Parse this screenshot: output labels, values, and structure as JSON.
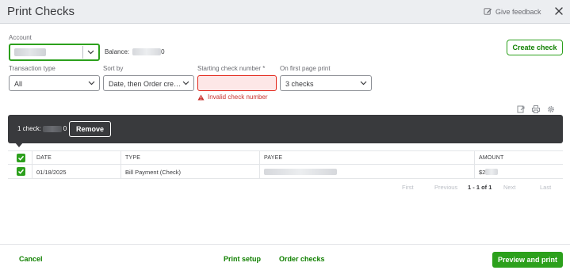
{
  "header": {
    "title": "Print Checks",
    "feedback_label": "Give feedback",
    "feedback_icon": "feedback-pencil-icon",
    "close_icon": "close-icon"
  },
  "form": {
    "account_label": "Account",
    "account_value": "",
    "balance_label": "Balance:",
    "balance_suffix": "0",
    "create_check_label": "Create check",
    "transaction_type_label": "Transaction type",
    "transaction_type_value": "All",
    "sort_by_label": "Sort by",
    "sort_by_value": "Date, then Order cre…",
    "starting_check_label": "Starting check number *",
    "starting_check_value": "",
    "starting_check_error": "Invalid check number",
    "first_page_label": "On first page print",
    "first_page_value": "3 checks"
  },
  "toolbar_icons": [
    "export-icon",
    "print-icon",
    "settings-icon"
  ],
  "selection_bar": {
    "count_text": "1 check:",
    "amount_suffix": "0",
    "remove_label": "Remove"
  },
  "table": {
    "columns": [
      "DATE",
      "TYPE",
      "PAYEE",
      "AMOUNT"
    ],
    "rows": [
      {
        "date": "01/18/2025",
        "type": "Bill Payment (Check)",
        "payee": "",
        "amount": "$2"
      }
    ]
  },
  "pager": {
    "first": "First",
    "previous": "Previous",
    "range": "1 - 1 of 1",
    "next": "Next",
    "last": "Last"
  },
  "footer": {
    "cancel_label": "Cancel",
    "print_setup_label": "Print setup",
    "order_checks_label": "Order checks",
    "preview_print_label": "Preview and print"
  },
  "colors": {
    "brand_green": "#2ca01c",
    "link_green": "#108000",
    "error_red": "#c9302c",
    "dark_bar": "#393a3d"
  }
}
